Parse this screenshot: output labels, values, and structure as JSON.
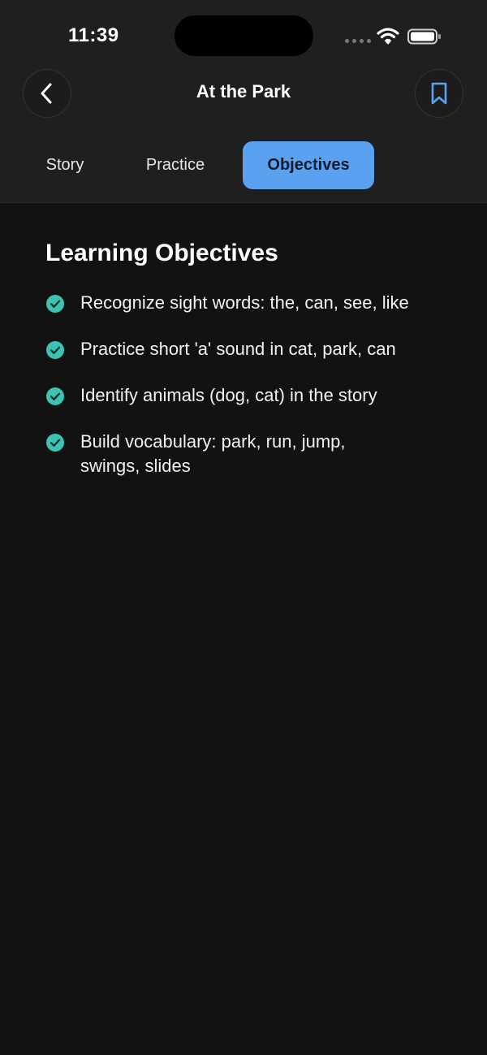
{
  "status_bar": {
    "time": "11:39"
  },
  "header": {
    "title": "At the Park",
    "back_icon": "chevron-left-icon",
    "bookmark_icon": "bookmark-icon"
  },
  "tabs": [
    {
      "label": "Story",
      "active": false
    },
    {
      "label": "Practice",
      "active": false
    },
    {
      "label": "Objectives",
      "active": true
    }
  ],
  "content": {
    "title": "Learning Objectives",
    "objectives": [
      "Recognize sight words: the, can, see, like",
      "Practice short 'a' sound in cat, park, can",
      "Identify animals (dog, cat) in the story",
      "Build vocabulary: park, run, jump, swings, slides"
    ]
  },
  "colors": {
    "accent": "#5aa2ef",
    "check": "#3cc3b4",
    "background": "#121212",
    "header_bg": "#1f1f1f"
  }
}
